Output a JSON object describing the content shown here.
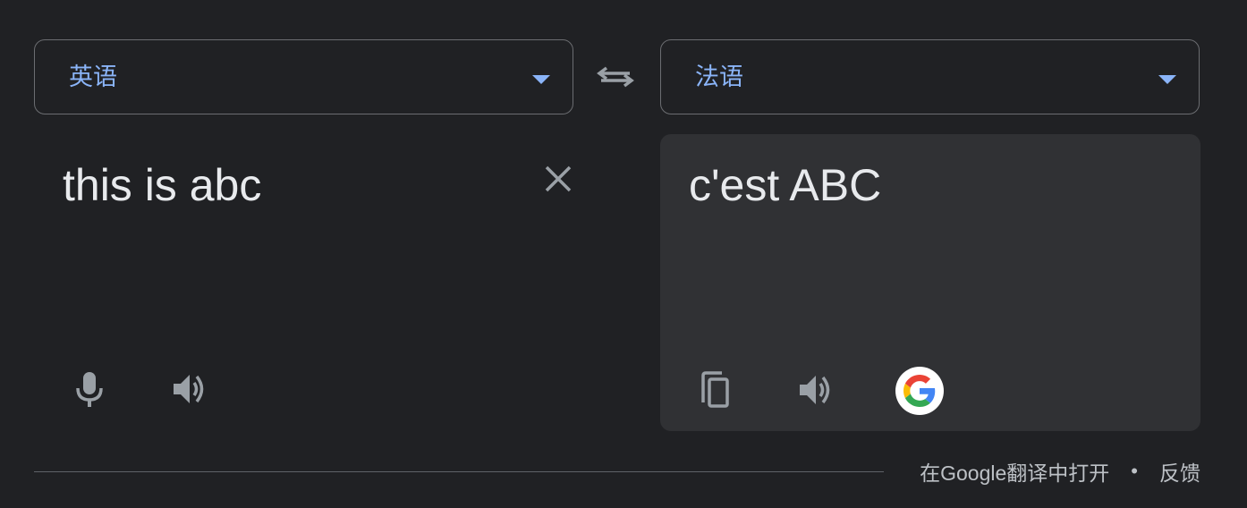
{
  "source_language": {
    "label": "英语",
    "icon": "chevron-down-icon"
  },
  "target_language": {
    "label": "法语",
    "icon": "chevron-down-icon"
  },
  "swap": {
    "icon": "swap-arrows-icon"
  },
  "source": {
    "text": "this is abc",
    "clear_icon": "close-icon",
    "mic_icon": "microphone-icon",
    "speaker_icon": "speaker-icon"
  },
  "target": {
    "text": "c'est ABC",
    "copy_icon": "copy-icon",
    "speaker_icon": "speaker-icon",
    "google_icon": "google-logo-icon"
  },
  "footer": {
    "open_in_google": "在Google翻译中打开",
    "separator": "•",
    "feedback": "反馈"
  },
  "colors": {
    "background": "#202124",
    "panel": "#303134",
    "accent": "#8ab4f8",
    "text": "#e8eaed",
    "icon": "#9aa0a6",
    "border": "#6b6d71"
  }
}
